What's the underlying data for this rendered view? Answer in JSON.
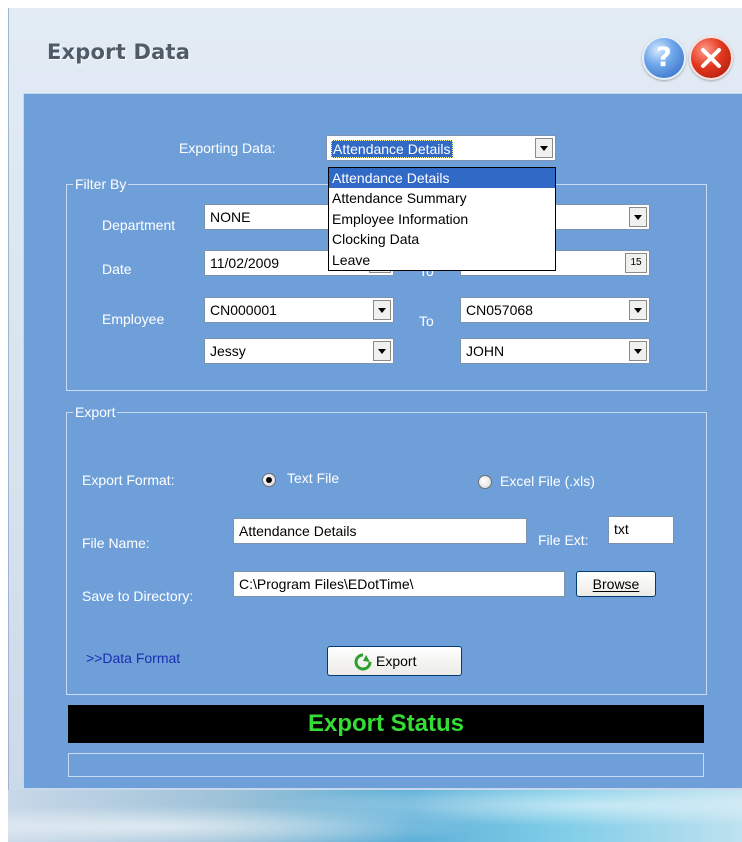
{
  "window": {
    "title": "Export Data"
  },
  "title_buttons": {
    "help": "?",
    "close": "close"
  },
  "exporting": {
    "label": "Exporting Data:",
    "selected": "Attendance Details",
    "options": [
      "Attendance Details",
      "Attendance Summary",
      "Employee Information",
      "Clocking Data",
      "Leave"
    ]
  },
  "filter": {
    "group_title": "Filter By",
    "department_label": "Department",
    "department_value": "NONE",
    "department_to_value": "",
    "date_label": "Date",
    "date_from": "11/02/2009",
    "date_to_label": "To",
    "date_to": "",
    "calendar_glyph": "15",
    "employee_label": "Employee",
    "employee_from_id": "CN000001",
    "employee_to_label": "To",
    "employee_to_id": "CN057068",
    "employee_from_name": "Jessy",
    "employee_to_name": "JOHN"
  },
  "export": {
    "group_title": "Export",
    "format_label": "Export Format:",
    "format_text": "Text File",
    "format_excel": "Excel File (.xls)",
    "selected_format": "Text File",
    "file_name_label": "File Name:",
    "file_name_value": "Attendance Details",
    "file_ext_label": "File Ext:",
    "file_ext_value": "txt",
    "directory_label": "Save to Directory:",
    "directory_value": "C:\\Program Files\\EDotTime\\",
    "browse_label": "Browse",
    "data_format_link": ">>Data Format",
    "export_button": "Export"
  },
  "status": {
    "text": "Export Status",
    "progress": 0
  },
  "colors": {
    "panel": "#6f9fd8",
    "status_bg": "#000000",
    "status_text": "#33dd33",
    "link": "#1a2fb0",
    "selection": "#3169c6"
  },
  "icons": [
    "help-icon",
    "close-icon",
    "dropdown-arrow-icon",
    "calendar-icon",
    "export-refresh-icon"
  ]
}
